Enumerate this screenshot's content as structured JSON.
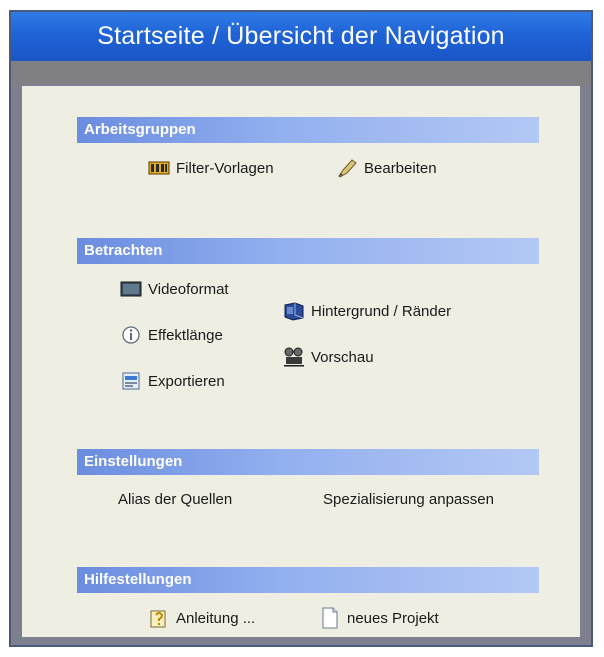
{
  "window": {
    "title": "Startseite / Übersicht der Navigation"
  },
  "sections": {
    "arbeitsgruppen": {
      "header": "Arbeitsgruppen",
      "items": [
        {
          "label": "Filter-Vorlagen",
          "icon": "filter-templates-icon"
        },
        {
          "label": "Bearbeiten",
          "icon": "edit-icon"
        }
      ]
    },
    "betrachten": {
      "header": "Betrachten",
      "items": [
        {
          "label": "Videoformat",
          "icon": "monitor-icon"
        },
        {
          "label": "Effektlänge",
          "icon": "info-icon"
        },
        {
          "label": "Exportieren",
          "icon": "export-icon"
        },
        {
          "label": "Hintergrund / Ränder",
          "icon": "background-icon"
        },
        {
          "label": "Vorschau",
          "icon": "projector-icon"
        }
      ]
    },
    "einstellungen": {
      "header": "Einstellungen",
      "items": [
        {
          "label": "Alias der Quellen"
        },
        {
          "label": "Spezialisierung anpassen"
        }
      ]
    },
    "hilfestellungen": {
      "header": "Hilfestellungen",
      "items": [
        {
          "label": "Anleitung ...",
          "icon": "help-icon"
        },
        {
          "label": "neues Projekt",
          "icon": "new-document-icon"
        }
      ]
    }
  },
  "colors": {
    "titlebar": "#1f63d6",
    "section_header": "#93b0ef",
    "content_background": "#efeee3"
  }
}
